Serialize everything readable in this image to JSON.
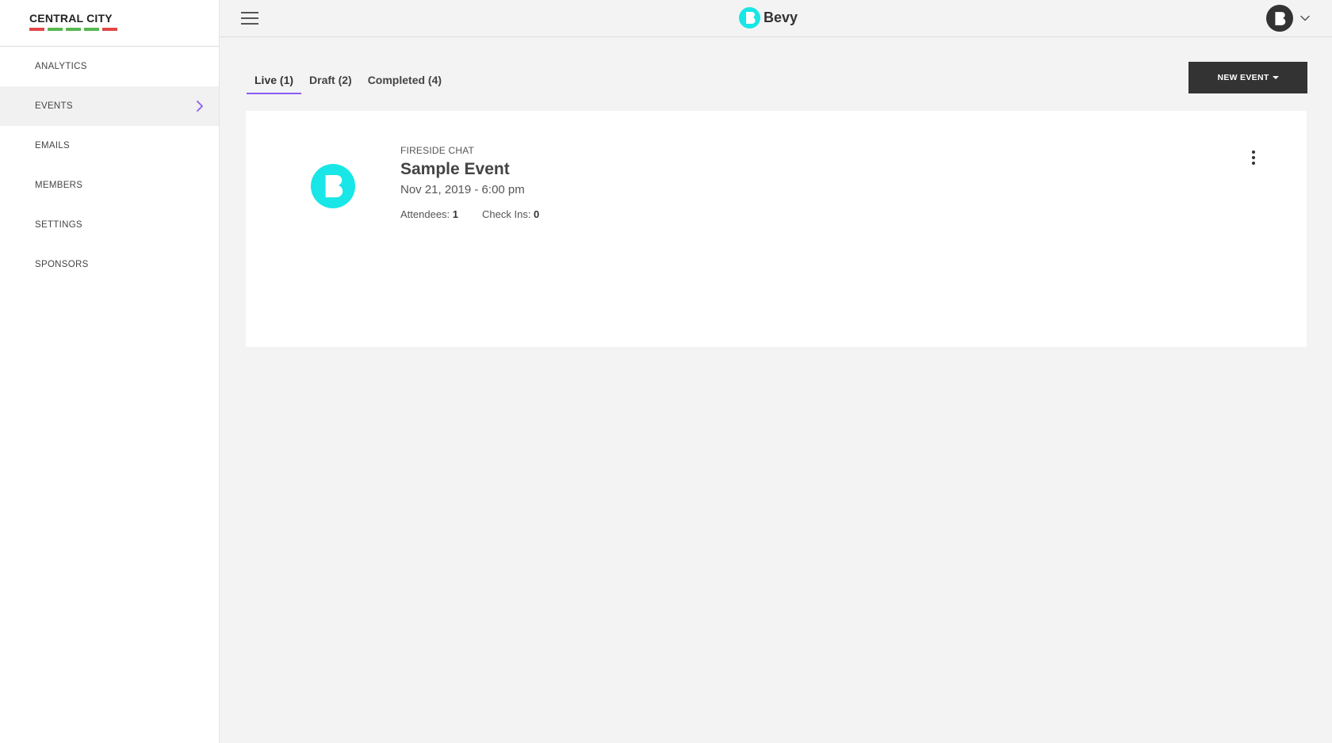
{
  "sidebar": {
    "brand": {
      "name": "CENTRAL CITY",
      "bar_colors": [
        "#e04848",
        "#57b84f",
        "#57b84f",
        "#57b84f",
        "#e04848"
      ]
    },
    "items": [
      {
        "label": "ANALYTICS",
        "active": false
      },
      {
        "label": "EVENTS",
        "active": true
      },
      {
        "label": "EMAILS",
        "active": false
      },
      {
        "label": "MEMBERS",
        "active": false
      },
      {
        "label": "SETTINGS",
        "active": false
      },
      {
        "label": "SPONSORS",
        "active": false
      }
    ]
  },
  "header": {
    "menu_icon": "hamburger-icon",
    "logo_text": "Bevy",
    "logo_color": "#19e6e6",
    "user_caret_icon": "chevron-down-icon"
  },
  "tabs": [
    {
      "label": "Live (1)",
      "active": true
    },
    {
      "label": "Draft (2)",
      "active": false
    },
    {
      "label": "Completed (4)",
      "active": false
    }
  ],
  "actions": {
    "new_event_label": "NEW EVENT"
  },
  "events": [
    {
      "type": "FIRESIDE CHAT",
      "title": "Sample Event",
      "date": "Nov 21, 2019 - 6:00 pm",
      "attendees_label": "Attendees:",
      "attendees_value": "1",
      "checkins_label": "Check Ins:",
      "checkins_value": "0"
    }
  ],
  "colors": {
    "accent": "#8b5cf6",
    "brand_cyan": "#19e6e6",
    "button_dark": "#333333"
  }
}
